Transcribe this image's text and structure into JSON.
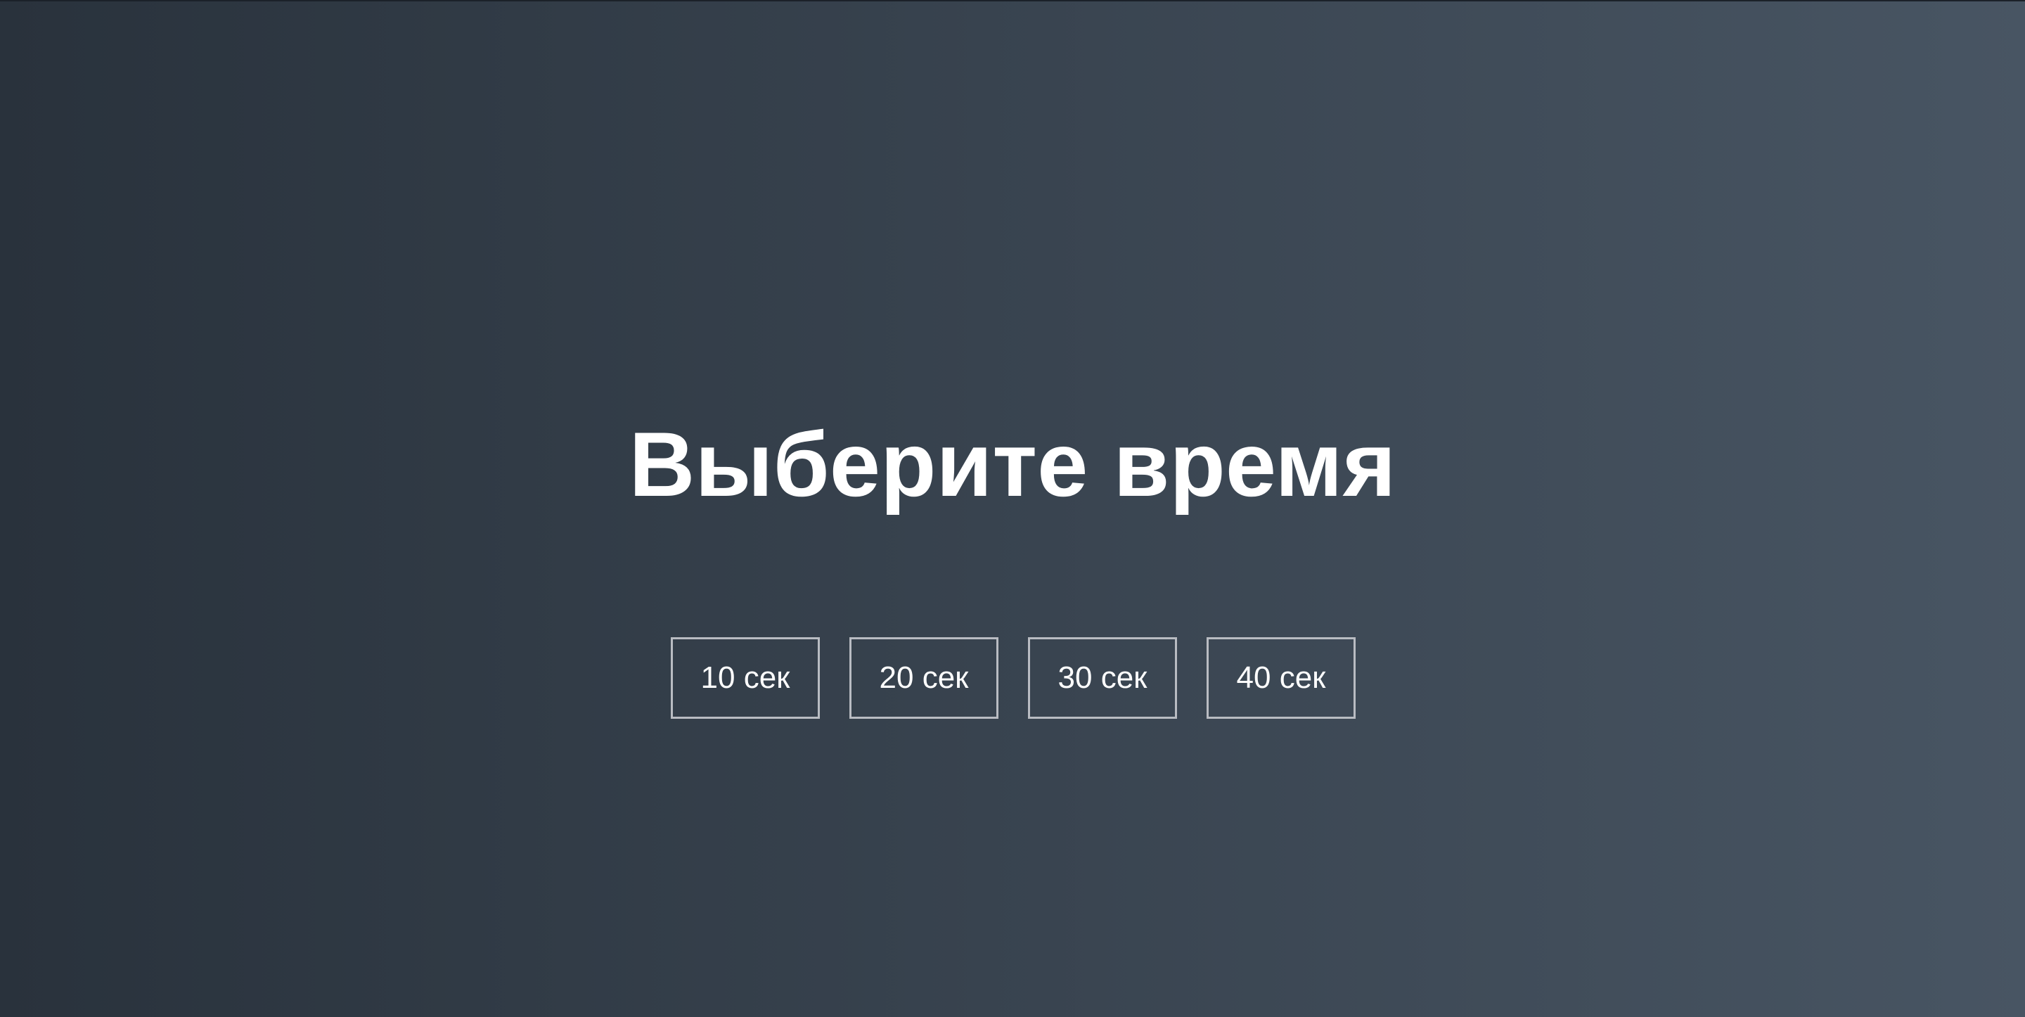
{
  "screen": {
    "title": "Выберите время",
    "time_options": [
      {
        "label": "10 сек"
      },
      {
        "label": "20 сек"
      },
      {
        "label": "30 сек"
      },
      {
        "label": "40 сек"
      }
    ]
  },
  "colors": {
    "background_start": "#29323c",
    "background_end": "#485563",
    "text": "#ffffff",
    "button_border": "#b9bcc2"
  }
}
